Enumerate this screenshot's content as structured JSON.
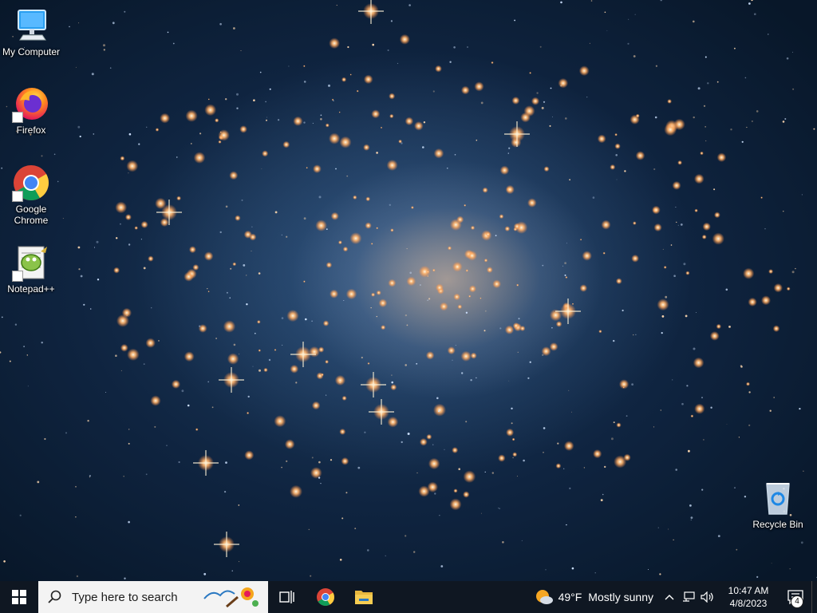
{
  "desktop": {
    "icons": [
      {
        "label": "My Computer",
        "icon": "computer-icon"
      },
      {
        "label": "Firefox",
        "icon": "firefox-icon"
      },
      {
        "label": "Google\nChrome",
        "icon": "chrome-icon"
      },
      {
        "label": "Notepad++",
        "icon": "notepadpp-icon"
      },
      {
        "label": "Recycle Bin",
        "icon": "recycle-bin-icon"
      }
    ]
  },
  "taskbar": {
    "start_icon": "windows-logo-icon",
    "search": {
      "placeholder": "Type here to search",
      "icon": "search-icon"
    },
    "task_view_icon": "task-view-icon",
    "pinned_apps": [
      {
        "name": "Google Chrome",
        "icon": "chrome-icon"
      },
      {
        "name": "File Explorer",
        "icon": "folder-icon"
      }
    ],
    "weather": {
      "temp": "49°F",
      "condition": "Mostly sunny",
      "icon": "partly-sunny-icon"
    },
    "tray_icons": [
      "chevron-up-icon",
      "network-icon",
      "volume-icon"
    ],
    "clock": {
      "time": "10:47 AM",
      "date": "4/8/2023"
    },
    "notifications": {
      "count": "4",
      "icon": "action-center-icon"
    }
  },
  "colors": {
    "taskbar_bg": "#0f1722",
    "search_bg": "#f3f3f3",
    "start_blue": "#ffffff"
  }
}
